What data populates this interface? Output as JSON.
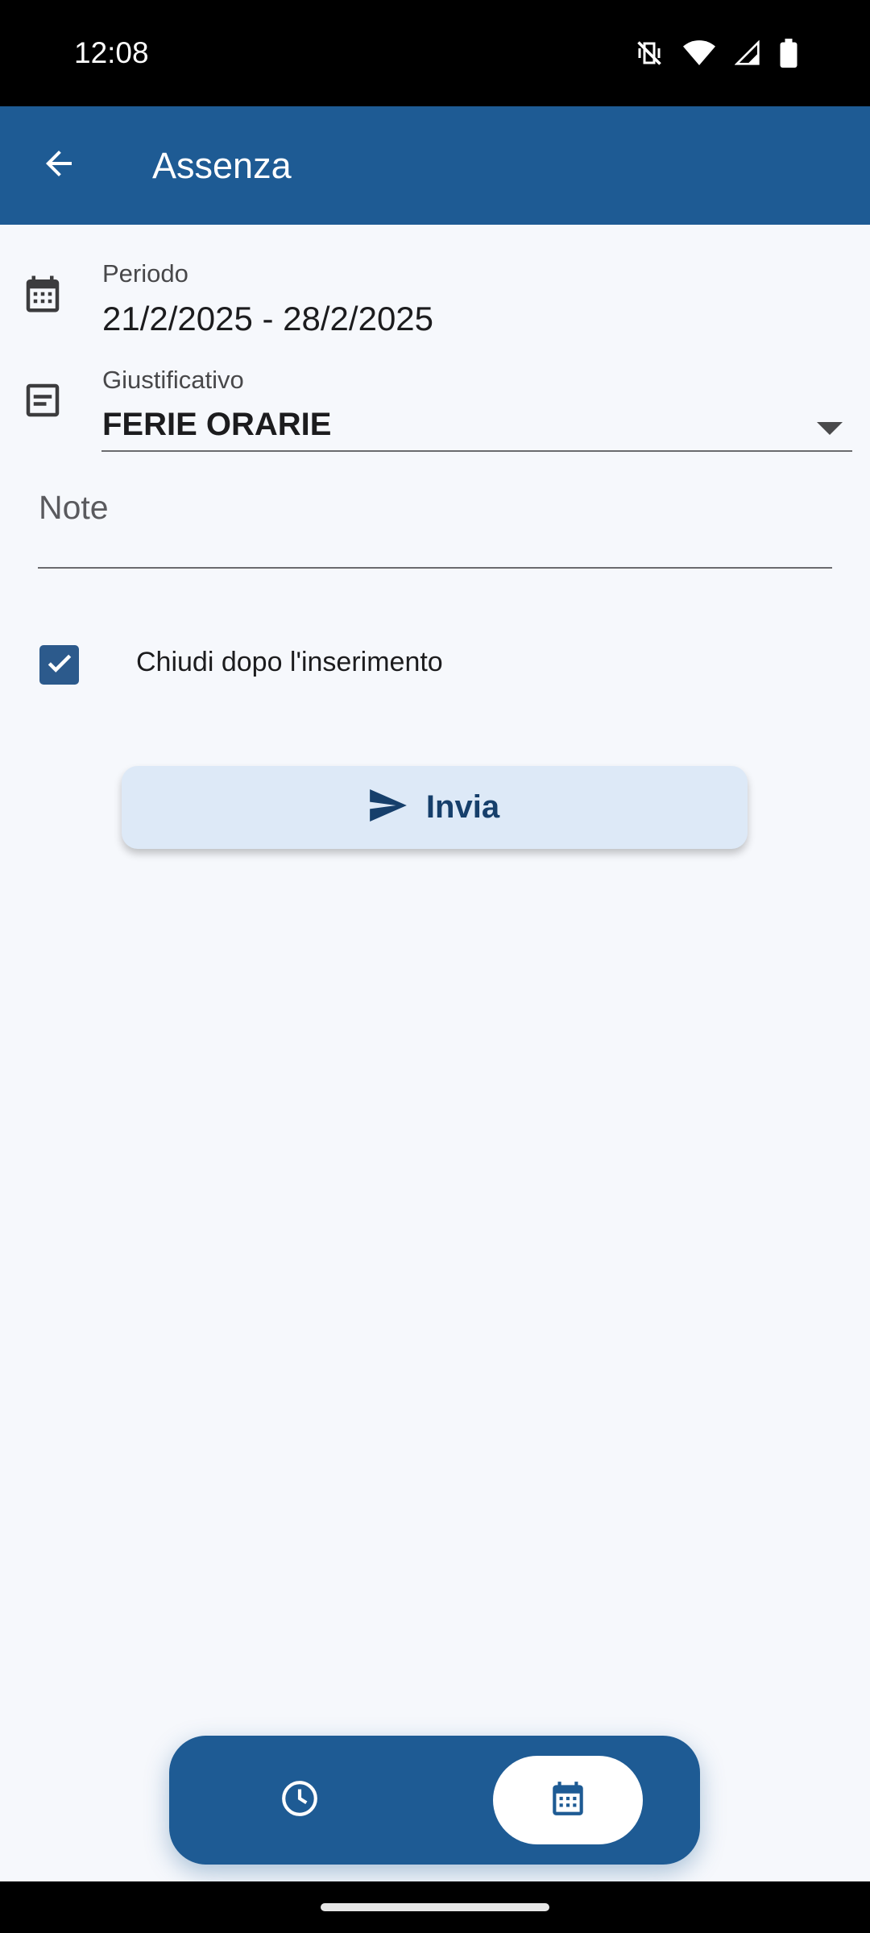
{
  "status_bar": {
    "time": "12:08",
    "icons": [
      "vibrate-off-icon",
      "wifi-icon",
      "signal-icon",
      "battery-icon"
    ]
  },
  "app_bar": {
    "title": "Assenza",
    "back_icon": "arrow-back-icon",
    "background": "#1e5b94"
  },
  "form": {
    "period": {
      "icon": "calendar-icon",
      "label": "Periodo",
      "value": "21/2/2025 - 28/2/2025"
    },
    "justification": {
      "icon": "notes-icon",
      "label": "Giustificativo",
      "selected": "FERIE ORARIE"
    },
    "note": {
      "label": "Note",
      "value": ""
    },
    "close_after": {
      "label": "Chiudi dopo l'inserimento",
      "checked": true
    },
    "submit": {
      "label": "Invia",
      "icon": "send-icon"
    }
  },
  "bottom_nav": {
    "items": [
      {
        "icon": "clock-icon",
        "selected": false
      },
      {
        "icon": "calendar-icon",
        "selected": true
      }
    ]
  },
  "colors": {
    "primary": "#1e5b94",
    "button_bg": "#dde9f7",
    "background": "#f6f8fc"
  }
}
